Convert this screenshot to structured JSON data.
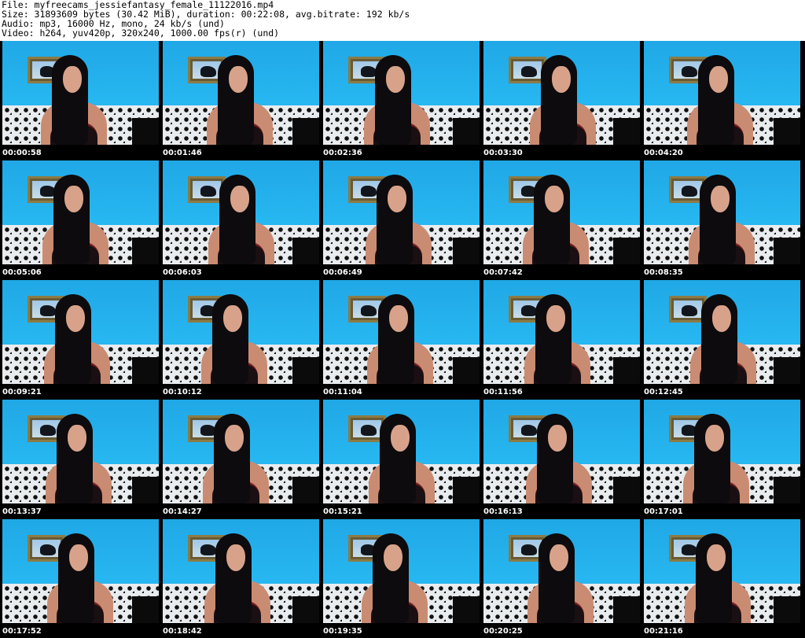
{
  "info": {
    "file": "File: myfreecams_jessiefantasy_female_11122016.mp4",
    "size": "Size: 31893609 bytes (30.42 MiB), duration: 00:22:08, avg.bitrate: 192 kb/s",
    "audio": "Audio: mp3, 16000 Hz, mono, 24 kb/s (und)",
    "video": "Video: h264, yuv420p, 320x240, 1000.00 fps(r) (und)"
  },
  "thumbnails": [
    "00:00:58",
    "00:01:46",
    "00:02:36",
    "00:03:30",
    "00:04:20",
    "00:05:06",
    "00:06:03",
    "00:06:49",
    "00:07:42",
    "00:08:35",
    "00:09:21",
    "00:10:12",
    "00:11:04",
    "00:11:56",
    "00:12:45",
    "00:13:37",
    "00:14:27",
    "00:15:21",
    "00:16:13",
    "00:17:01",
    "00:17:52",
    "00:18:42",
    "00:19:35",
    "00:20:25",
    "00:21:16"
  ]
}
